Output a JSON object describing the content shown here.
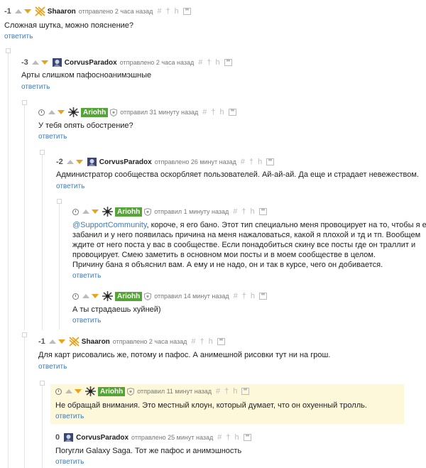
{
  "ui": {
    "reply_label": "ответить",
    "icons": {
      "hash": "#",
      "pin": "†",
      "h": "h",
      "save": "save-icon",
      "clock": "clock-icon",
      "up": "upvote-arrow-icon",
      "down": "downvote-arrow-icon"
    },
    "colors": {
      "link": "#3a7bbf",
      "badge": "#55a437",
      "down": "#e8a318",
      "highlight": "#fdf8da"
    }
  },
  "comments": [
    {
      "rating": "-1",
      "author": "Shaaron",
      "time": "отправлено 2 часа назад",
      "text": [
        "Сложная шутка, можно пояснение?"
      ]
    },
    {
      "rating": "-3",
      "author": "CorvusParadox",
      "time": "отправлено 2 часа назад",
      "text": [
        "Арты слишком пафосноанимэшные"
      ]
    },
    {
      "rating": "",
      "author": "Ariohh",
      "time": "отправил 31 минуту назад",
      "text": [
        "У тебя опять обострение?"
      ]
    },
    {
      "rating": "-2",
      "author": "CorvusParadox",
      "time": "отправлено 26 минут назад",
      "text": [
        "Администратор сообщества оскорбляет пользователей. Ай-ай-ай. Да еще и страдает невежеством."
      ]
    },
    {
      "rating": "",
      "author": "Ariohh",
      "time": "отправил 1 минуту назад",
      "mention": "@SupportCommunity",
      "text": [
        ", короче, я его бано. Этот тип специально меня провоцирует на то, чтобы я его",
        "забанил и у него появилась причина на меня нажаловаться, какой я плохой и тд и тп. Вообщем",
        "ждите от него поста у вас в сообществе. Если понадобиться скину все посты где он траллит и",
        "провоцирует. Смею заметить в основном мои посты и в моем сообществе в целом.",
        "Причину бана я объяснил вам. А ему и не надо, он и так в курсе, чего он добивается."
      ]
    },
    {
      "rating": "",
      "author": "Ariohh",
      "time": "отправил 14 минут назад",
      "text": [
        "А ты страдаешь хуйней)"
      ]
    },
    {
      "rating": "-1",
      "author": "Shaaron",
      "time": "отправлено 2 часа назад",
      "text": [
        "Для карт рисовались же, потому и пафос. А анимешной рисовки тут ни на грош."
      ]
    },
    {
      "rating": "",
      "author": "Ariohh",
      "time": "отправил 11 минут назад",
      "text": [
        "Не обращай внимания. Это местный клоун, который думает, что он охуенный тролль."
      ]
    },
    {
      "rating": "0",
      "author": "CorvusParadox",
      "time": "отправлено 25 минут назад",
      "text": [
        "Погугли Galaxy Saga. Тот же пафос и анимэшность"
      ]
    }
  ]
}
